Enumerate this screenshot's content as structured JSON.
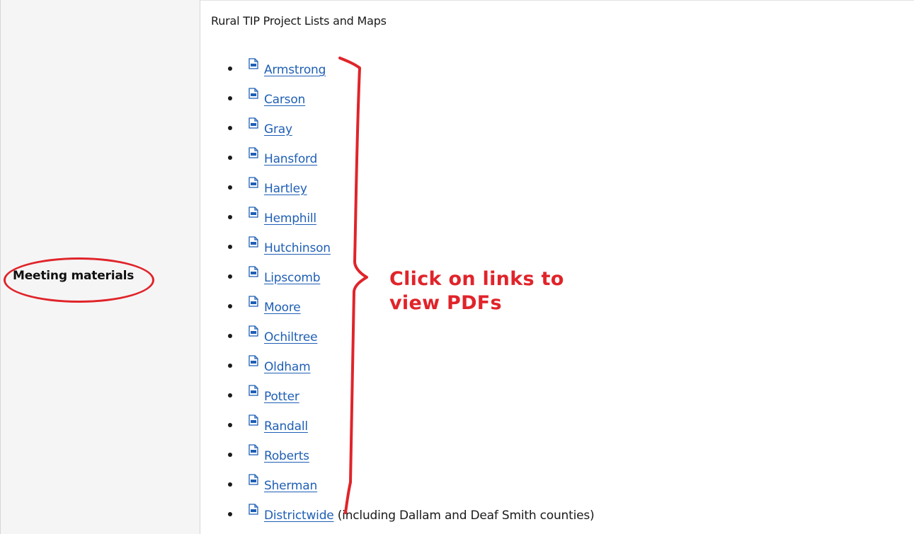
{
  "left_cell": {
    "label": "Meeting materials"
  },
  "main": {
    "title": "Rural TIP Project Lists and Maps",
    "links": [
      {
        "label": "Armstrong",
        "suffix": ""
      },
      {
        "label": "Carson",
        "suffix": ""
      },
      {
        "label": "Gray",
        "suffix": ""
      },
      {
        "label": "Hansford",
        "suffix": ""
      },
      {
        "label": "Hartley",
        "suffix": ""
      },
      {
        "label": "Hemphill",
        "suffix": ""
      },
      {
        "label": "Hutchinson",
        "suffix": ""
      },
      {
        "label": "Lipscomb",
        "suffix": ""
      },
      {
        "label": "Moore",
        "suffix": ""
      },
      {
        "label": "Ochiltree",
        "suffix": ""
      },
      {
        "label": "Oldham",
        "suffix": ""
      },
      {
        "label": "Potter",
        "suffix": ""
      },
      {
        "label": "Randall",
        "suffix": ""
      },
      {
        "label": "Roberts",
        "suffix": ""
      },
      {
        "label": "Sherman",
        "suffix": ""
      },
      {
        "label": "Districtwide",
        "suffix": " (including Dallam and Deaf Smith counties)"
      }
    ],
    "link_icon": "pdf-file-icon"
  },
  "annotation": {
    "callout_line1": "Click on links to",
    "callout_line2": "view PDFs",
    "color": "#e0242a"
  },
  "colors": {
    "link": "#1f5fb5",
    "left_bg": "#f5f5f5"
  }
}
